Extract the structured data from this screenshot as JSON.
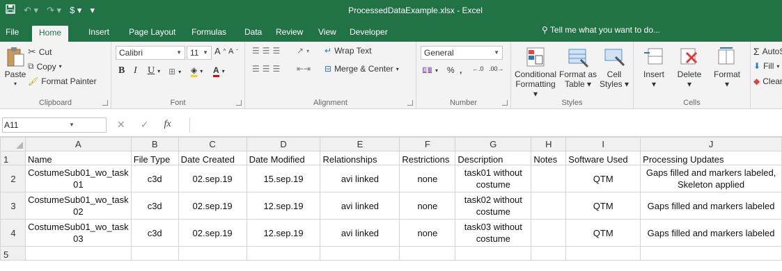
{
  "window": {
    "title": "ProcessedDataExample.xlsx - Excel"
  },
  "quick_access": {
    "save_icon": "save-icon",
    "undo_icon": "undo-icon",
    "redo_icon": "redo-icon"
  },
  "tabs": [
    {
      "label": "File"
    },
    {
      "label": "Home",
      "active": true
    },
    {
      "label": "Insert"
    },
    {
      "label": "Page Layout"
    },
    {
      "label": "Formulas"
    },
    {
      "label": "Data"
    },
    {
      "label": "Review"
    },
    {
      "label": "View"
    },
    {
      "label": "Developer"
    }
  ],
  "tell_me": "Tell me what you want to do...",
  "ribbon": {
    "clipboard": {
      "label": "Clipboard",
      "paste": "Paste",
      "cut": "Cut",
      "copy": "Copy",
      "format_painter": "Format Painter"
    },
    "font": {
      "label": "Font",
      "name": "Calibri",
      "size": "11",
      "bold": "B",
      "italic": "I",
      "underline": "U"
    },
    "alignment": {
      "label": "Alignment",
      "wrap_text": "Wrap Text",
      "merge_center": "Merge & Center"
    },
    "number": {
      "label": "Number",
      "format": "General",
      "percent": "%",
      "comma": ","
    },
    "styles": {
      "label": "Styles",
      "conditional": "Conditional",
      "conditional2": "Formatting",
      "format_as": "Format as",
      "format_as2": "Table",
      "cell": "Cell",
      "cell2": "Styles"
    },
    "cells": {
      "label": "Cells",
      "insert": "Insert",
      "delete": "Delete",
      "format": "Format"
    },
    "editing": {
      "autosum": "AutoSum",
      "fill": "Fill",
      "clear": "Clear"
    }
  },
  "formula_bar": {
    "name_box": "A11",
    "fx": "fx",
    "value": ""
  },
  "sheet": {
    "columns": [
      "A",
      "B",
      "C",
      "D",
      "E",
      "F",
      "G",
      "H",
      "I",
      "J"
    ],
    "row_numbers": [
      "1",
      "2",
      "3",
      "4",
      "5"
    ],
    "header": [
      "Name",
      "File Type",
      "Date Created",
      "Date Modified",
      "Relationships",
      "Restrictions",
      "Description",
      "Notes",
      "Software Used",
      "Processing Updates"
    ],
    "rows": [
      [
        "CostumeSub01_wo_task01",
        "c3d",
        "02.sep.19",
        "15.sep.19",
        "avi linked",
        "none",
        "task01 without costume",
        "",
        "QTM",
        "Gaps filled and markers labeled, Skeleton applied"
      ],
      [
        "CostumeSub01_wo_task02",
        "c3d",
        "02.sep.19",
        "12.sep.19",
        "avi linked",
        "none",
        "task02 without costume",
        "",
        "QTM",
        "Gaps filled and markers labeled"
      ],
      [
        "CostumeSub01_wo_task03",
        "c3d",
        "02.sep.19",
        "12.sep.19",
        "avi linked",
        "none",
        "task03 without costume",
        "",
        "QTM",
        "Gaps filled and markers labeled"
      ]
    ]
  },
  "colors": {
    "excel_green": "#217346",
    "ribbon_bg": "#f3f3f3",
    "grid_line": "#d4d4d4"
  }
}
